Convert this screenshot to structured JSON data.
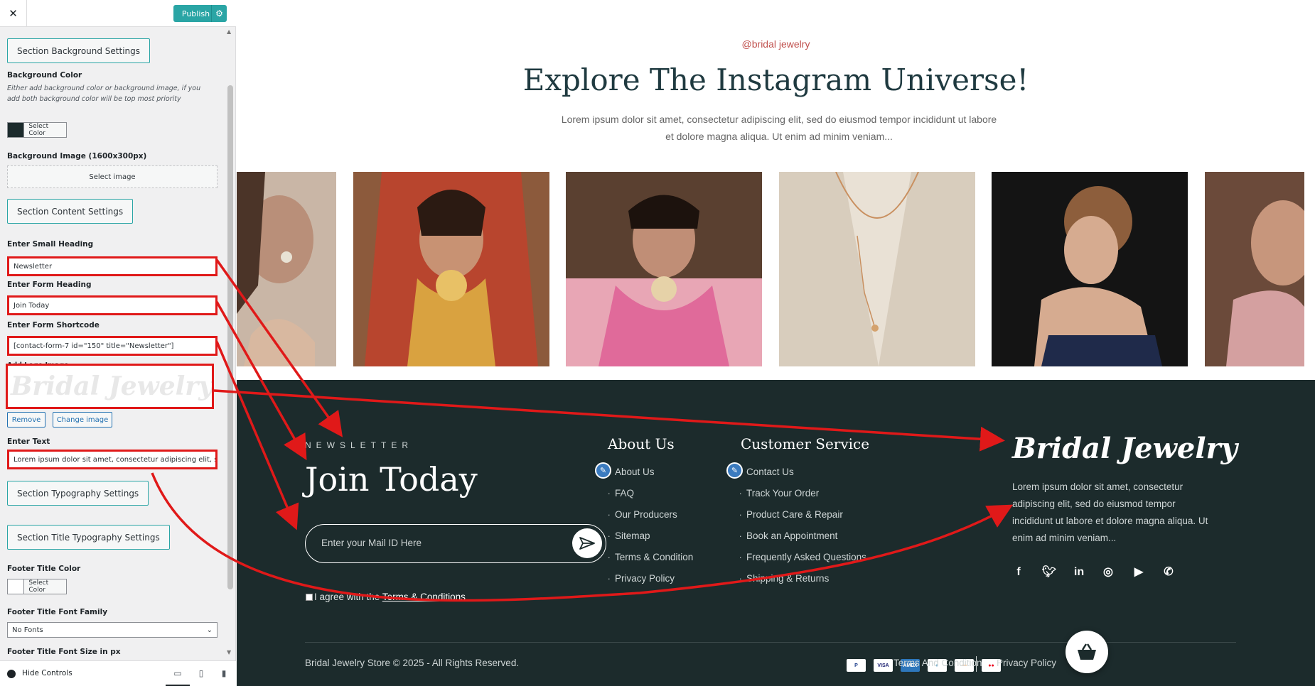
{
  "sidebar": {
    "close": "✕",
    "publish": "Publish",
    "sections": {
      "bg_settings": "Section Background Settings",
      "content_settings": "Section Content Settings",
      "typo_settings": "Section Typography Settings",
      "title_typo_settings": "Section Title Typography Settings"
    },
    "bg_color_label": "Background Color",
    "bg_color_desc": "Either add background color or background image, if you add both background color will be top most priority",
    "select_color": "Select Color",
    "bg_image_label": "Background Image (1600x300px)",
    "select_image": "Select image",
    "small_heading_label": "Enter Small Heading",
    "small_heading_value": "Newsletter",
    "form_heading_label": "Enter Form Heading",
    "form_heading_value": "Join Today",
    "shortcode_label": "Enter Form Shortcode",
    "shortcode_value": "[contact-form-7 id=\"150\" title=\"Newsletter\"]",
    "logo_label": "Add Logo Image",
    "logo_text": "Bridal Jewelry",
    "remove": "Remove",
    "change_image": "Change image",
    "text_label": "Enter Text",
    "text_value": "Lorem ipsum dolor sit amet, consectetur adipiscing elit, sed do eiusmod",
    "footer_title_color_label": "Footer Title Color",
    "footer_font_family_label": "Footer Title Font Family",
    "font_value": "No Fonts",
    "footer_font_size_label": "Footer Title Font Size in px",
    "hide_controls": "Hide Controls",
    "colors": {
      "bg_swatch": "#1c2b2c",
      "title_swatch": "#ffffff",
      "accent": "#2aa5a5"
    }
  },
  "instagram": {
    "small_heading": "@bridal jewelry",
    "heading": "Explore The Instagram Universe!",
    "text": "Lorem ipsum dolor sit amet, consectetur adipiscing elit, sed do eiusmod tempor incididunt ut labore et dolore magna aliqua. Ut enim ad minim veniam..."
  },
  "footer": {
    "newsletter_small": "NEWSLETTER",
    "newsletter_heading": "Join Today",
    "mail_placeholder": "Enter your Mail ID Here",
    "agree_prefix": "I agree with the ",
    "agree_link": "Terms & Conditions",
    "about_heading": "About Us",
    "about_links": [
      "About Us",
      "FAQ",
      "Our Producers",
      "Sitemap",
      "Terms & Condition",
      "Privacy Policy"
    ],
    "service_heading": "Customer Service",
    "service_links": [
      "Contact Us",
      "Track Your Order",
      "Product Care & Repair",
      "Book an Appointment",
      "Frequently Asked Questions",
      "Shipping & Returns"
    ],
    "brand": "Bridal Jewelry",
    "brand_text": "Lorem ipsum dolor sit amet, consectetur adipiscing elit, sed do eiusmod tempor incididunt ut labore et dolore magna aliqua. Ut enim ad minim veniam...",
    "social_icons": [
      "facebook-icon",
      "twitter-icon",
      "linkedin-icon",
      "instagram-icon",
      "youtube-icon",
      "whatsapp-icon"
    ],
    "copyright": "Bridal Jewelry Store © 2025 - All Rights Reserved.",
    "payments": [
      "PayPal",
      "VISA",
      "AMEX",
      "Diners",
      "Discover",
      "Mastercard"
    ],
    "terms_link": "Terms And Condition",
    "privacy_link": "Privacy Policy",
    "bg_color": "#1c2b2c"
  }
}
